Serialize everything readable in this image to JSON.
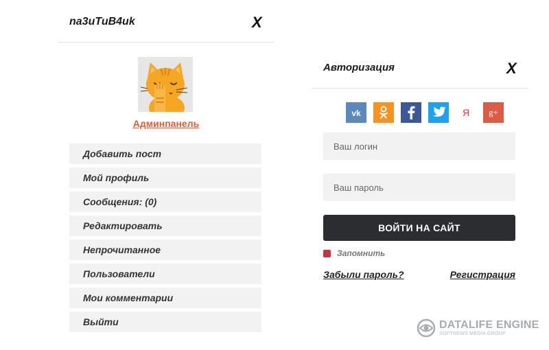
{
  "user_panel": {
    "username": "na3uTuB4uk",
    "close_label": "X",
    "admin_link": "Админпанель",
    "menu": [
      {
        "label": "Добавить пост"
      },
      {
        "label": "Мой профиль"
      },
      {
        "label": "Сообщения: (0)"
      },
      {
        "label": "Редактировать"
      },
      {
        "label": "Непрочитанное"
      },
      {
        "label": "Пользователи"
      },
      {
        "label": "Мои комментарии"
      },
      {
        "label": "Выйти"
      }
    ]
  },
  "login_panel": {
    "title": "Авторизация",
    "close_label": "X",
    "socials": [
      {
        "name": "vk",
        "icon": "vk-icon",
        "glyph": "vk",
        "color": "#5b88bd"
      },
      {
        "name": "odnoklassniki",
        "icon": "odnoklassniki-icon",
        "glyph": "ok",
        "color": "#f7931e"
      },
      {
        "name": "facebook",
        "icon": "facebook-icon",
        "glyph": "f",
        "color": "#3b5998"
      },
      {
        "name": "twitter",
        "icon": "twitter-icon",
        "glyph": "t",
        "color": "#1da1f2"
      },
      {
        "name": "yandex",
        "icon": "yandex-icon",
        "glyph": "Я",
        "color": "#ffffff"
      },
      {
        "name": "google-plus",
        "icon": "google-plus-icon",
        "glyph": "g+",
        "color": "#dc5b45"
      }
    ],
    "login_placeholder": "Ваш логин",
    "password_placeholder": "Ваш пароль",
    "submit_label": "ВОЙТИ НА САЙТ",
    "remember_label": "Запомнить",
    "forgot_label": "Забыли пароль?",
    "register_label": "Регистрация"
  },
  "watermark": {
    "title": "DATALIFE ENGINE",
    "subtitle": "SOFTNEWS MEDIA GROUP"
  },
  "colors": {
    "accent": "#e25b33",
    "button_dark": "#2b2d31",
    "checkbox": "#c8333d",
    "field_bg": "#f2f2f2"
  }
}
